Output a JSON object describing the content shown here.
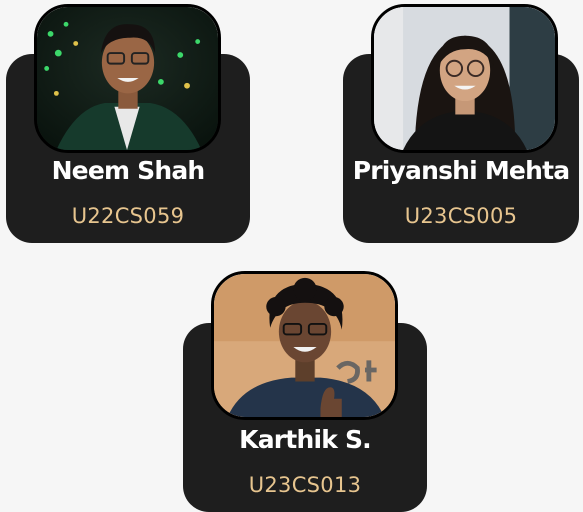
{
  "members": [
    {
      "name": "Neem Shah",
      "id": "U22CS059",
      "photo_alt": "profile photo"
    },
    {
      "name": "Priyanshi Mehta",
      "id": "U23CS005",
      "photo_alt": "profile photo"
    },
    {
      "name": "Karthik S.",
      "id": "U23CS013",
      "photo_alt": "profile photo"
    }
  ],
  "colors": {
    "background": "#f6f6f6",
    "card": "#1e1e1e",
    "name_text": "#ffffff",
    "id_text": "#e7c58f"
  }
}
